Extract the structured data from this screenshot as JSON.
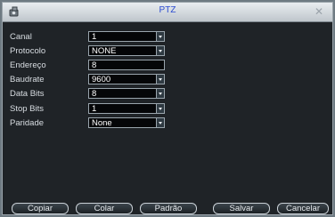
{
  "window": {
    "title": "PTZ",
    "close_symbol": "✕"
  },
  "fields": {
    "canal": {
      "label": "Canal",
      "value": "1"
    },
    "protocolo": {
      "label": "Protocolo",
      "value": "NONE"
    },
    "endereco": {
      "label": "Endereço",
      "value": "8"
    },
    "baudrate": {
      "label": "Baudrate",
      "value": "9600"
    },
    "databits": {
      "label": "Data Bits",
      "value": "8"
    },
    "stopbits": {
      "label": "Stop Bits",
      "value": "1"
    },
    "paridade": {
      "label": "Paridade",
      "value": "None"
    }
  },
  "buttons": {
    "copiar": "Copiar",
    "colar": "Colar",
    "padrao": "Padrão",
    "salvar": "Salvar",
    "cancelar": "Cancelar"
  },
  "icons": {
    "app": "camera-icon",
    "close": "close-icon",
    "dropdown": "chevron-down-icon"
  }
}
